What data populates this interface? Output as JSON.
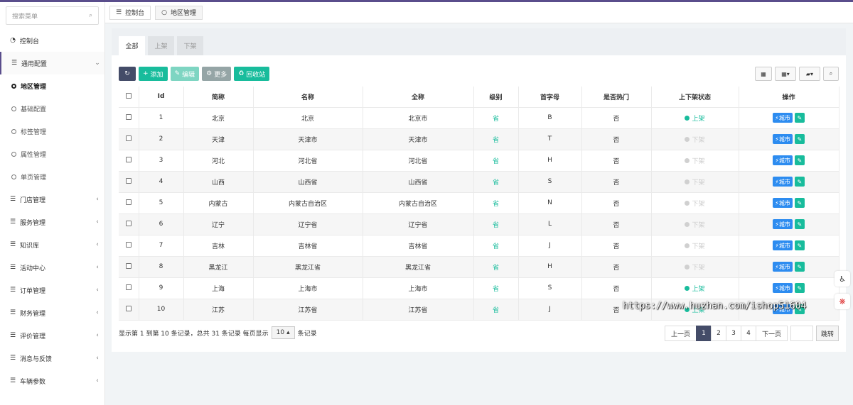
{
  "sidebar": {
    "search_placeholder": "搜索菜单",
    "items": [
      {
        "label": "控制台",
        "icon": "dashboard-icon"
      },
      {
        "label": "通用配置",
        "icon": "list-icon"
      },
      {
        "label": "门店管理",
        "icon": "list-icon"
      },
      {
        "label": "服务管理",
        "icon": "list-icon"
      },
      {
        "label": "知识库",
        "icon": "list-icon"
      },
      {
        "label": "活动中心",
        "icon": "list-icon"
      },
      {
        "label": "订单管理",
        "icon": "list-icon"
      },
      {
        "label": "财务管理",
        "icon": "list-icon"
      },
      {
        "label": "评价管理",
        "icon": "list-icon"
      },
      {
        "label": "消息与反馈",
        "icon": "list-icon"
      },
      {
        "label": "车辆参数",
        "icon": "list-icon"
      }
    ],
    "subitems": [
      "地区管理",
      "基础配置",
      "标签管理",
      "属性管理",
      "单页管理"
    ]
  },
  "page_tabs": [
    "控制台",
    "地区管理"
  ],
  "filter_tabs": [
    "全部",
    "上架",
    "下架"
  ],
  "toolbar": {
    "add": "添加",
    "edit": "编辑",
    "more": "更多",
    "recycle": "回收站"
  },
  "table": {
    "headers": [
      "Id",
      "简称",
      "名称",
      "全称",
      "级别",
      "首字母",
      "是否热门",
      "上下架状态",
      "操作"
    ],
    "rows": [
      {
        "id": "1",
        "short": "北京",
        "name": "北京",
        "full": "北京市",
        "level": "省",
        "letter": "B",
        "hot": "否",
        "status": "上架",
        "on": true
      },
      {
        "id": "2",
        "short": "天津",
        "name": "天津市",
        "full": "天津市",
        "level": "省",
        "letter": "T",
        "hot": "否",
        "status": "下架",
        "on": false
      },
      {
        "id": "3",
        "short": "河北",
        "name": "河北省",
        "full": "河北省",
        "level": "省",
        "letter": "H",
        "hot": "否",
        "status": "下架",
        "on": false
      },
      {
        "id": "4",
        "short": "山西",
        "name": "山西省",
        "full": "山西省",
        "level": "省",
        "letter": "S",
        "hot": "否",
        "status": "下架",
        "on": false
      },
      {
        "id": "5",
        "short": "内蒙古",
        "name": "内蒙古自治区",
        "full": "内蒙古自治区",
        "level": "省",
        "letter": "N",
        "hot": "否",
        "status": "下架",
        "on": false
      },
      {
        "id": "6",
        "short": "辽宁",
        "name": "辽宁省",
        "full": "辽宁省",
        "level": "省",
        "letter": "L",
        "hot": "否",
        "status": "下架",
        "on": false
      },
      {
        "id": "7",
        "short": "吉林",
        "name": "吉林省",
        "full": "吉林省",
        "level": "省",
        "letter": "J",
        "hot": "否",
        "status": "下架",
        "on": false
      },
      {
        "id": "8",
        "short": "黑龙江",
        "name": "黑龙江省",
        "full": "黑龙江省",
        "level": "省",
        "letter": "H",
        "hot": "否",
        "status": "下架",
        "on": false
      },
      {
        "id": "9",
        "short": "上海",
        "name": "上海市",
        "full": "上海市",
        "level": "省",
        "letter": "S",
        "hot": "否",
        "status": "上架",
        "on": true
      },
      {
        "id": "10",
        "short": "江苏",
        "name": "江苏省",
        "full": "江苏省",
        "level": "省",
        "letter": "J",
        "hot": "否",
        "status": "上架",
        "on": true
      }
    ],
    "op_city": "城市"
  },
  "footer": {
    "summary": "显示第 1 到第 10 条记录，总共 31 条记录 每页显示",
    "per_page": "10",
    "suffix": "条记录"
  },
  "pager": {
    "prev": "上一页",
    "pages": [
      "1",
      "2",
      "3",
      "4"
    ],
    "next": "下一页",
    "jump": "跳转"
  },
  "watermark": "https://www.huzhan.com/ishop51604"
}
